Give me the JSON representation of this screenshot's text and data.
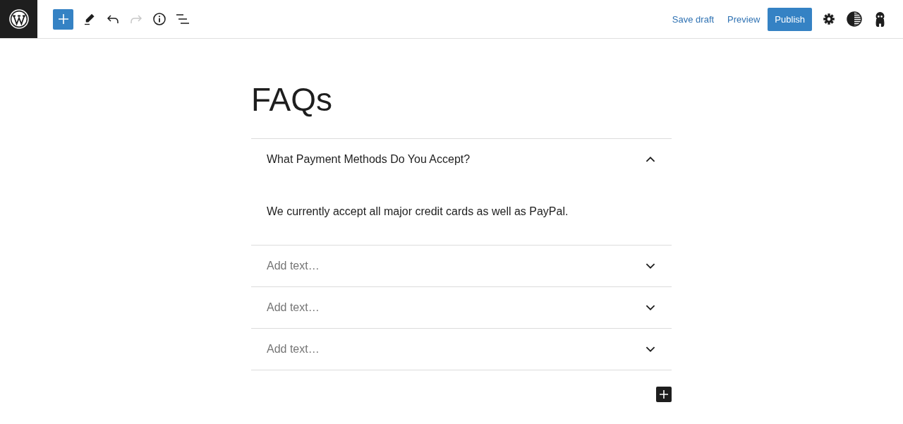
{
  "toolbar": {
    "tools": [
      {
        "kind": "add",
        "disabled": false
      },
      {
        "kind": "edit",
        "disabled": false
      },
      {
        "kind": "undo",
        "disabled": false
      },
      {
        "kind": "redo",
        "disabled": true
      },
      {
        "kind": "info",
        "disabled": false
      },
      {
        "kind": "list",
        "disabled": false
      }
    ],
    "actions": [
      {
        "kind": "link",
        "label": "Save draft"
      },
      {
        "kind": "link",
        "label": "Preview"
      },
      {
        "kind": "primary",
        "label": "Publish"
      }
    ],
    "panels": [
      {
        "kind": "settings"
      },
      {
        "kind": "styles"
      },
      {
        "kind": "plugin"
      }
    ]
  },
  "document": {
    "title": "FAQs",
    "faq": [
      {
        "question": "What Payment Methods Do You Accept?",
        "answer": "We currently accept all major credit cards as well as PayPal.",
        "expanded": true
      },
      {
        "placeholder": "Add text…",
        "expanded": false
      },
      {
        "placeholder": "Add text…",
        "expanded": false
      },
      {
        "placeholder": "Add text…",
        "expanded": false
      }
    ]
  }
}
